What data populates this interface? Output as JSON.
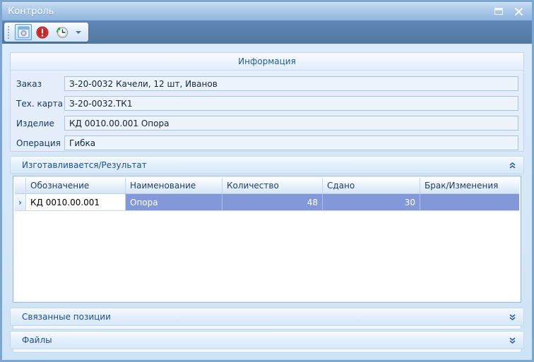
{
  "window": {
    "title": "Контроль",
    "controls": {
      "maximize": "maximize",
      "close": "close"
    }
  },
  "toolbar": {
    "buttons": [
      {
        "icon": "form-settings-icon",
        "state": "active"
      },
      {
        "icon": "error-icon",
        "state": "normal"
      },
      {
        "icon": "history-clock-icon",
        "state": "normal"
      }
    ],
    "dropdown_icon": "chevron-down-icon"
  },
  "info": {
    "title": "Информация",
    "fields": [
      {
        "label": "Заказ",
        "value": "З-20-0032 Качели, 12 шт, Иванов"
      },
      {
        "label": "Тех. карта",
        "value": "З-20-0032.ТК1"
      },
      {
        "label": "Изделие",
        "value": "КД 0010.00.001 Опора"
      },
      {
        "label": "Операция",
        "value": "Гибка"
      }
    ]
  },
  "result_section": {
    "title": "Изготавливается/Результат",
    "state": "expanded",
    "table": {
      "columns": [
        "Обозначение",
        "Наименование",
        "Количество",
        "Сдано",
        "Брак/Изменения"
      ],
      "row_indicator": "›",
      "rows": [
        {
          "designation": "КД 0010.00.001",
          "name": "Опора",
          "quantity": "48",
          "delivered": "30",
          "defects": ""
        }
      ]
    }
  },
  "collapsed_sections": [
    {
      "title": "Связанные позиции",
      "state": "collapsed"
    },
    {
      "title": "Файлы",
      "state": "collapsed"
    }
  ],
  "colors": {
    "titlebar_top": "#c9ddf2",
    "titlebar_bottom": "#8fb4de",
    "toolbar_band": "#54799f",
    "selection_row": "#8298d9",
    "header_text": "#1b4f8f",
    "error_icon_red": "#cc2222",
    "history_arrow_green": "#2fa32f"
  }
}
